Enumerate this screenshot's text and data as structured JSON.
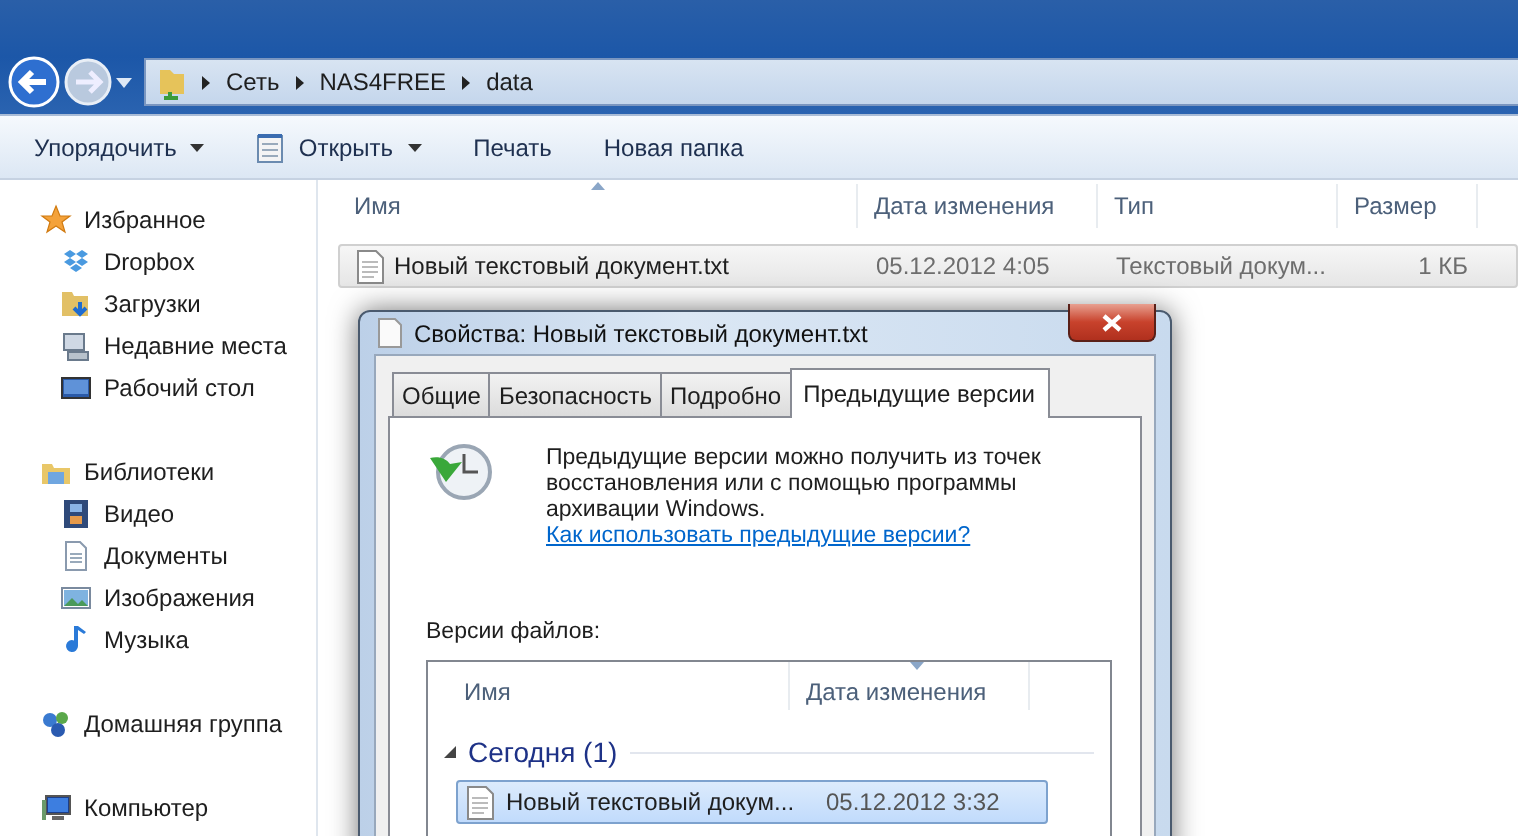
{
  "nav": {
    "breadcrumb": [
      "Сеть",
      "NAS4FREE",
      "data"
    ]
  },
  "toolbar": {
    "buttons": [
      {
        "label": "Упорядочить",
        "kind": "dropdown"
      },
      {
        "label": "Открыть",
        "kind": "icon-dropdown"
      },
      {
        "label": "Печать",
        "kind": "plain"
      },
      {
        "label": "Новая папка",
        "kind": "plain"
      }
    ]
  },
  "sidebar": {
    "groups": [
      {
        "label": "Избранное",
        "items": [
          "Dropbox",
          "Загрузки",
          "Недавние места",
          "Рабочий стол"
        ]
      },
      {
        "label": "Библиотеки",
        "items": [
          "Видео",
          "Документы",
          "Изображения",
          "Музыка"
        ]
      },
      {
        "label": "Домашняя группа"
      },
      {
        "label": "Компьютер"
      }
    ]
  },
  "table": {
    "columns": [
      {
        "label": "Имя",
        "sorted": true
      },
      {
        "label": "Дата изменения",
        "sorted": false
      },
      {
        "label": "Тип",
        "sorted": false
      },
      {
        "label": "Размер",
        "sorted": false
      }
    ],
    "rows": [
      {
        "name": "Новый текстовый документ.txt",
        "date": "05.12.2012 4:05",
        "type": "Текстовый докум...",
        "size": "1 КБ",
        "selected": true
      }
    ]
  },
  "dialog": {
    "title": "Свойства: Новый текстовый документ.txt",
    "tabs": [
      {
        "label": "Общие",
        "selected": false
      },
      {
        "label": "Безопасность",
        "selected": false
      },
      {
        "label": "Подробно",
        "selected": false
      },
      {
        "label": "Предыдущие версии",
        "selected": true
      }
    ],
    "description": "Предыдущие версии можно получить из точек восстановления или с помощью программы архивации Windows.",
    "link": "Как использовать предыдущие версии?",
    "versions_label": "Версии файлов:",
    "columns": [
      {
        "label": "Имя",
        "sorted": false
      },
      {
        "label": "Дата изменения",
        "sorted": true
      }
    ],
    "groups": [
      {
        "label": "Сегодня (1)",
        "expanded": true,
        "rows": [
          {
            "name": "Новый текстовый докум...",
            "date": "05.12.2012 3:32",
            "selected": true
          }
        ]
      }
    ]
  }
}
